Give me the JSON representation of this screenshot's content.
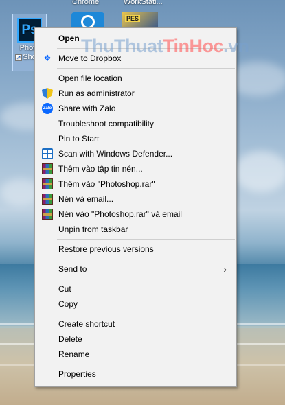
{
  "desktop": {
    "icon_top_labels": [
      "Chrome",
      "WorkStati..."
    ],
    "photoshop_icon": {
      "tile_text": "Ps",
      "label_line1": "Photo",
      "label_line2": "Sho"
    }
  },
  "watermark": {
    "part1": "ThuThuat",
    "part2": "TinHoc",
    "part3": ".vn"
  },
  "menu": {
    "items": [
      {
        "label": "Open",
        "bold": true,
        "icon": ""
      },
      {
        "sep": true
      },
      {
        "label": "Move to Dropbox",
        "icon": "dropbox-icon"
      },
      {
        "sep": true
      },
      {
        "label": "Open file location",
        "icon": ""
      },
      {
        "label": "Run as administrator",
        "icon": "shield-icon"
      },
      {
        "label": "Share with Zalo",
        "icon": "zalo-icon"
      },
      {
        "label": "Troubleshoot compatibility",
        "icon": ""
      },
      {
        "label": "Pin to Start",
        "icon": ""
      },
      {
        "label": "Scan with Windows Defender...",
        "icon": "defender-icon"
      },
      {
        "label": "Thêm vào tập tin nén...",
        "icon": "winrar-icon"
      },
      {
        "label": "Thêm vào \"Photoshop.rar\"",
        "icon": "winrar-icon"
      },
      {
        "label": "Nén và email...",
        "icon": "winrar-icon"
      },
      {
        "label": "Nén vào \"Photoshop.rar\" và email",
        "icon": "winrar-icon"
      },
      {
        "label": "Unpin from taskbar",
        "icon": ""
      },
      {
        "sep": true
      },
      {
        "label": "Restore previous versions",
        "icon": ""
      },
      {
        "sep": true
      },
      {
        "label": "Send to",
        "icon": "",
        "submenu": true
      },
      {
        "sep": true
      },
      {
        "label": "Cut",
        "icon": ""
      },
      {
        "label": "Copy",
        "icon": ""
      },
      {
        "sep": true
      },
      {
        "label": "Create shortcut",
        "icon": ""
      },
      {
        "label": "Delete",
        "icon": ""
      },
      {
        "label": "Rename",
        "icon": ""
      },
      {
        "sep": true
      },
      {
        "label": "Properties",
        "icon": ""
      }
    ],
    "submenu_glyph": "›",
    "zalo_icon_text": "Zalo",
    "dropbox_icon_glyph": "❖"
  }
}
